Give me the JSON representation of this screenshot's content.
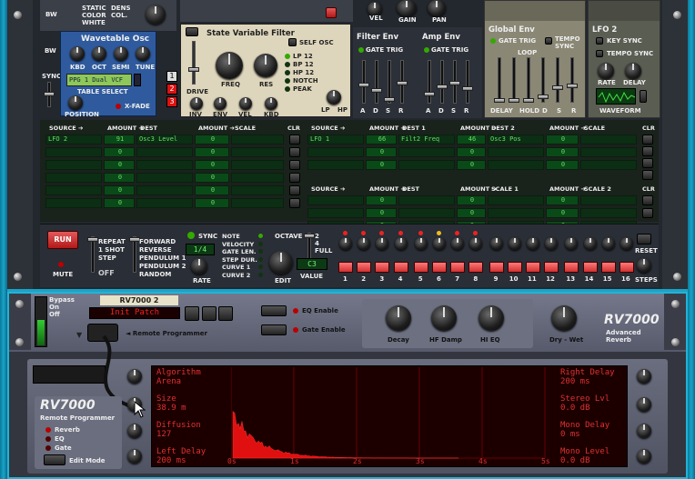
{
  "osc": {
    "bw": "BW",
    "static": "STATIC",
    "dens": "DENS",
    "color": "COLOR",
    "col": "COL.",
    "white": "WHITE",
    "sync": "SYNC",
    "title": "Wavetable Osc",
    "kbd": "KBD",
    "oct": "OCT",
    "semi": "SEMI",
    "tune": "TUNE",
    "patch": "PPG 1 Dual VCF",
    "table_select": "TABLE SELECT",
    "position": "POSITION",
    "xfade": "X-FADE",
    "numbers": [
      "1",
      "2",
      "3"
    ]
  },
  "filter": {
    "title": "State Variable Filter",
    "self_osc": "SELF OSC",
    "drive": "DRIVE",
    "freq": "FREQ",
    "res": "RES",
    "inv": "INV",
    "env": "ENV",
    "vel": "VEL",
    "kbd": "KBD",
    "modes": [
      "LP 12",
      "BP 12",
      "HP 12",
      "NOTCH",
      "PEAK"
    ],
    "lp": "LP",
    "hp": "HP",
    "top_labels": [
      "VEL",
      "GAIN",
      "PAN"
    ]
  },
  "filter_env": {
    "title": "Filter Env",
    "gate_trig": "GATE TRIG",
    "adsr": [
      "A",
      "D",
      "S",
      "R"
    ]
  },
  "amp_env": {
    "title": "Amp Env",
    "gate_trig": "GATE TRIG",
    "adsr": [
      "A",
      "D",
      "S",
      "R"
    ]
  },
  "global_env": {
    "title": "Global Env",
    "gate_trig": "GATE TRIG",
    "tempo": "TEMPO",
    "sync": "SYNC",
    "loop": "LOOP",
    "delay": "DELAY",
    "hold": "HOLD",
    "d": "D",
    "s": "S",
    "r": "R"
  },
  "lfo2": {
    "title": "LFO 2",
    "key_sync": "KEY SYNC",
    "tempo_sync": "TEMPO SYNC",
    "rate": "RATE",
    "delay": "DELAY",
    "waveform": "WAVEFORM"
  },
  "matrix": {
    "left_headers": [
      "SOURCE ➔",
      "AMOUNT ➔",
      "DEST",
      "AMOUNT ➔",
      "SCALE"
    ],
    "left_rows": [
      [
        "LFO 2",
        "91",
        "Osc3 Level",
        "0",
        ""
      ],
      [
        "",
        "0",
        "",
        "0",
        ""
      ],
      [
        "",
        "0",
        "",
        "0",
        ""
      ],
      [
        "",
        "0",
        "",
        "0",
        ""
      ],
      [
        "",
        "0",
        "",
        "0",
        ""
      ],
      [
        "",
        "0",
        "",
        "0",
        ""
      ]
    ],
    "right_headers": [
      "SOURCE ➔",
      "AMOUNT ➔",
      "DEST 1",
      "AMOUNT ➔",
      "DEST 2",
      "AMOUNT ➔",
      "SCALE"
    ],
    "right_rows": [
      [
        "LFO 1",
        "66",
        "Filt2 Freq",
        "46",
        "Osc3 Pos",
        "0",
        ""
      ],
      [
        "",
        "0",
        "",
        "0",
        "",
        "0",
        ""
      ],
      [
        "",
        "0",
        "",
        "0",
        "",
        "0",
        ""
      ]
    ],
    "right2_headers": [
      "SOURCE ➔",
      "AMOUNT ➔",
      "DEST",
      "AMOUNT ➔",
      "SCALE 1",
      "AMOUNT ➔",
      "SCALE 2"
    ],
    "right2_rows": [
      [
        "",
        "0",
        "",
        "0",
        "",
        "0",
        ""
      ],
      [
        "",
        "0",
        "",
        "0",
        "",
        "0",
        ""
      ],
      [
        "",
        "0",
        "",
        "0",
        "",
        "0",
        ""
      ]
    ],
    "clr": "CLR"
  },
  "seq": {
    "run": "RUN",
    "mute": "MUTE",
    "modes": [
      "REPEAT",
      "1 SHOT",
      "STEP"
    ],
    "off": "OFF",
    "dirs": [
      "FORWARD",
      "REVERSE",
      "PENDULUM 1",
      "PENDULUM 2",
      "RANDOM"
    ],
    "sync": "SYNC",
    "rate_val": "1/4",
    "rate": "RATE",
    "dests": [
      "NOTE",
      "VELOCITY",
      "GATE LEN.",
      "STEP DUR.",
      "CURVE 1",
      "CURVE 2"
    ],
    "octave": "OCTAVE",
    "oct_opts": [
      "2",
      "4",
      "FULL"
    ],
    "edit": "EDIT",
    "value": "C3",
    "value_lbl": "VALUE",
    "steps": [
      "1",
      "2",
      "3",
      "4",
      "5",
      "6",
      "7",
      "8",
      "9",
      "10",
      "11",
      "12",
      "13",
      "14",
      "15",
      "16"
    ],
    "reset": "RESET",
    "steps_lbl": "STEPS"
  },
  "rv": {
    "bypass": "Bypass",
    "on": "On",
    "off": "Off",
    "name": "RV7000 2",
    "patch": "Init Patch",
    "remote_prog": "◄ Remote Programmer",
    "eq_enable": "EQ Enable",
    "gate_enable": "Gate Enable",
    "decay": "Decay",
    "hf_damp": "HF Damp",
    "hi_eq": "HI EQ",
    "dry_wet": "Dry - Wet",
    "logo": "RV7000",
    "sub1": "Advanced",
    "sub2": "Reverb"
  },
  "rp": {
    "logo": "RV7000",
    "sub": "Remote Programmer",
    "modes": [
      "Reverb",
      "EQ",
      "Gate"
    ],
    "edit_mode": "Edit Mode",
    "left": [
      [
        "Algorithm",
        "Arena"
      ],
      [
        "Size",
        "38.9 m"
      ],
      [
        "Diffusion",
        "127"
      ],
      [
        "Left Delay",
        "200 ms"
      ]
    ],
    "right": [
      [
        "Right Delay",
        "200 ms"
      ],
      [
        "Stereo Lvl",
        "0.0 dB"
      ],
      [
        "Mono Delay",
        "0 ms"
      ],
      [
        "Mono Level",
        "0.0 dB"
      ]
    ],
    "time_ticks": [
      "0s",
      "1s",
      "2s",
      "3s",
      "4s",
      "5s"
    ]
  },
  "colors": {
    "rack": "#2a2e35",
    "matrix": "#1d2a1e",
    "screen_red": "#1e0000",
    "reverb": "#ff1010",
    "rv_body": "#5a5e6e"
  }
}
